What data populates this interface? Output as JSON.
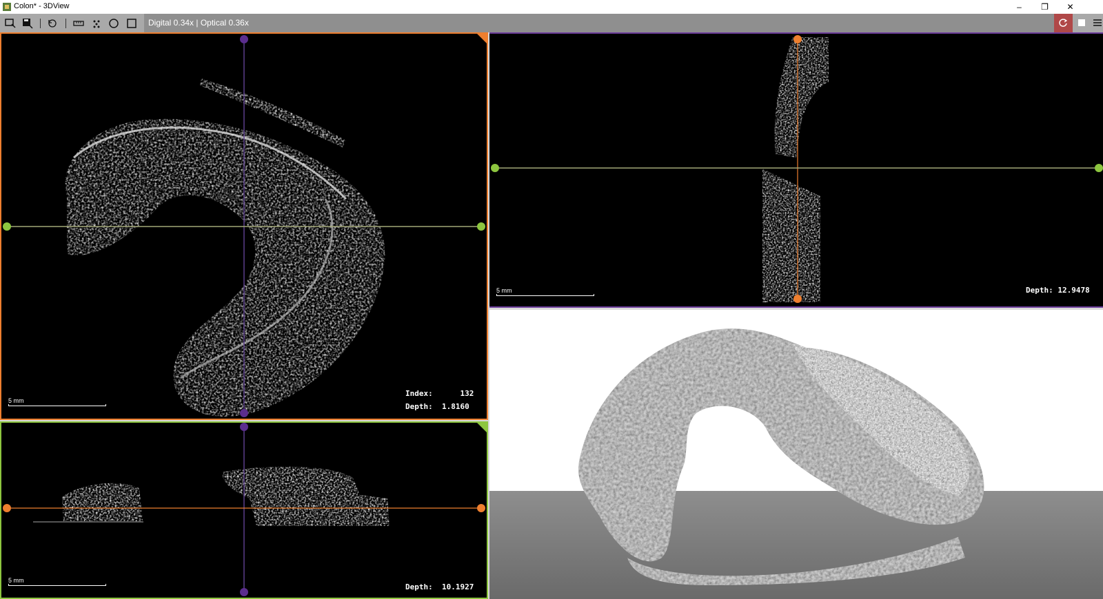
{
  "window": {
    "title": "Colon* - 3DView",
    "minimize_label": "–",
    "restore_label": "❐",
    "close_label": "✕"
  },
  "toolbar": {
    "zoom_readout": "Digital 0.34x | Optical 0.36x",
    "icons": [
      "select-region-icon",
      "save-region-icon",
      "reset-view-icon",
      "ruler-icon",
      "point-marker-icon",
      "circle-icon",
      "rectangle-icon",
      "refresh-icon",
      "fill-square-icon",
      "menu-icon"
    ]
  },
  "views": {
    "axial": {
      "index_label": "Index:",
      "index_value": "132",
      "depth_label": "Depth:",
      "depth_value": "1.8160",
      "scale_label": "5 mm",
      "border_color": "#ee7f2f"
    },
    "coronal": {
      "depth_label": "Depth:",
      "depth_value": "10.1927",
      "scale_label": "5 mm",
      "border_color": "#8dc63f"
    },
    "sagittal": {
      "depth_label": "Depth:",
      "depth_value": "12.9478",
      "scale_label": "5 mm",
      "border_color": "#6c3d9b"
    },
    "render3d": {
      "background": "#ffffff",
      "floor_color": "#7a7a7a"
    }
  },
  "crosshair_colors": {
    "purple": "#5b2d8e",
    "green": "#8dc63f",
    "orange": "#ee7f2f",
    "horizontal_line": "#a3a878",
    "vertical_line": "#5a3d8a"
  }
}
